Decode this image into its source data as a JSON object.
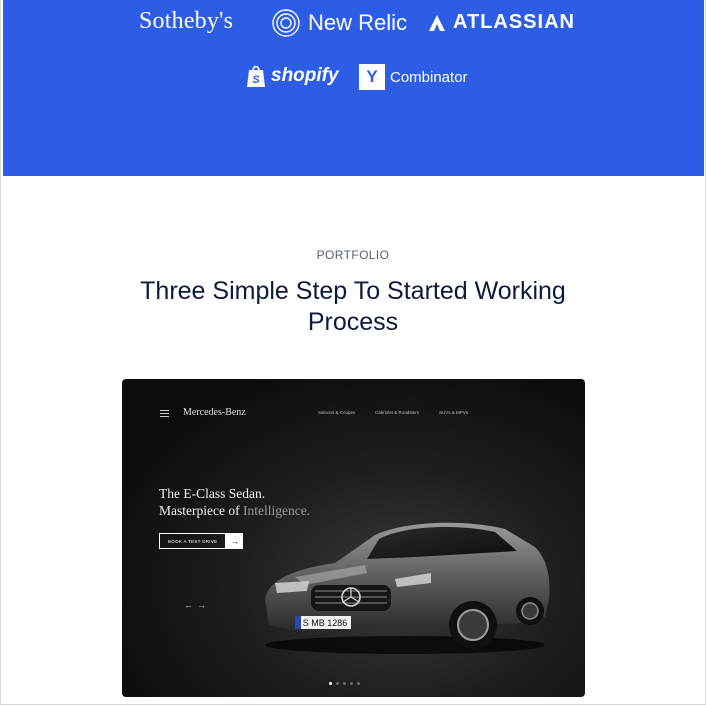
{
  "brand_colors": {
    "band": "#2d5de5",
    "heading": "#0d1a3b",
    "eyebrow": "#545f71"
  },
  "logos": {
    "sothebys": "Sotheby's",
    "new_relic": "New Relic",
    "new_relic_icon": "concentric-rings-icon",
    "atlassian": "ATLASSIAN",
    "atlassian_icon": "atlassian-triangle-icon",
    "shopify": "shopify",
    "shopify_icon": "shopping-bag-icon",
    "yc_mark": "Y",
    "yc_text": "Combinator"
  },
  "section": {
    "eyebrow": "PORTFOLIO",
    "heading_line1": "Three Simple Step To Started Working",
    "heading_line2": "Process"
  },
  "mockup": {
    "brand": "Mercedes-Benz",
    "nav_links": [
      "Saloons & Coupes",
      "Cabriolet & Roadsters",
      "SUVs & MPVs"
    ],
    "headline_line1": "The E-Class Sedan.",
    "headline_line2_a": "Masterpiece of ",
    "headline_line2_b": "Intelligence.",
    "cta_label": "BOOK A TEST DRIVE",
    "cta_arrow": "→",
    "slider_arrows": "←→",
    "plate_text": "S MB 1286",
    "slides_total": 5,
    "slide_active": 1
  }
}
